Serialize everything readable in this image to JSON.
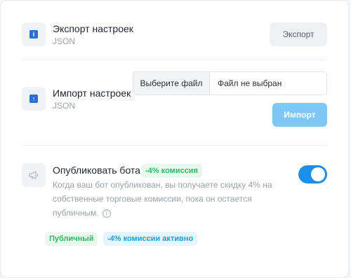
{
  "export": {
    "title": "Экспорт настроек",
    "subtitle": "JSON",
    "button_label": "Экспорт",
    "icon": "info-emoji-icon"
  },
  "import": {
    "title": "Импорт настроек",
    "subtitle": "JSON",
    "file_choose_label": "Выберите файл",
    "file_status": "Файл не выбран",
    "button_label": "Импорт",
    "icon": "up-arrow-emoji-icon"
  },
  "publish": {
    "title": "Опубликовать бота",
    "commission_badge": "-4% комиссия",
    "description": "Когда ваш бот опубликован, вы получаете скидку 4% на собственные торговые комиссии, пока он остается публичным.",
    "toggle_on": true,
    "status_badge": "Публичный",
    "active_badge": "-4% комиссии активно",
    "icon": "megaphone-icon"
  },
  "colors": {
    "accent": "#1e8fe8",
    "import_button": "#7ec8f5",
    "green_badge_text": "#2fb865",
    "blue_badge_text": "#1d9fd6"
  }
}
